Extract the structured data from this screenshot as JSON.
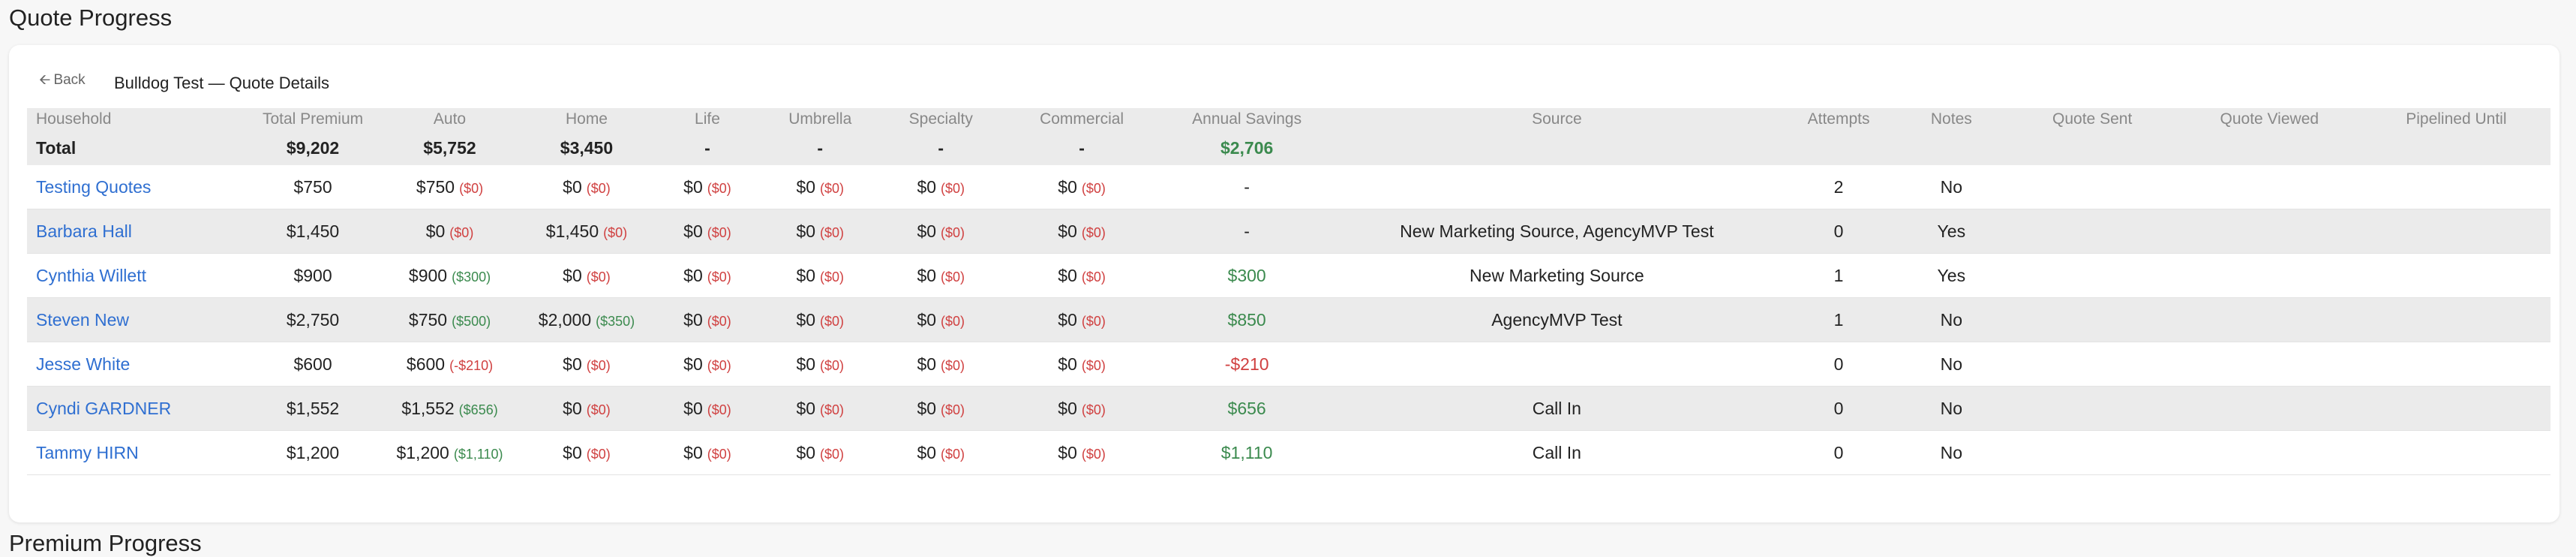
{
  "page": {
    "title": "Quote Progress",
    "next_section_title": "Premium Progress"
  },
  "card": {
    "back_label": "Back",
    "back_icon": "arrow-left-icon",
    "title": "Bulldog Test — Quote Details"
  },
  "colors": {
    "link": "#2f6fd1",
    "positive": "#3b8a4e",
    "negative": "#d04040",
    "stripe": "#ebebeb"
  },
  "table": {
    "headers": {
      "household": "Household",
      "total_premium": "Total Premium",
      "auto": "Auto",
      "home": "Home",
      "life": "Life",
      "umbrella": "Umbrella",
      "specialty": "Specialty",
      "commercial": "Commercial",
      "annual_savings": "Annual Savings",
      "source": "Source",
      "attempts": "Attempts",
      "notes": "Notes",
      "quote_sent": "Quote Sent",
      "quote_viewed": "Quote Viewed",
      "pipelined_until": "Pipelined Until"
    },
    "total": {
      "label": "Total",
      "total_premium": "$9,202",
      "auto": "$5,752",
      "home": "$3,450",
      "life": "-",
      "umbrella": "-",
      "specialty": "-",
      "commercial": "-",
      "annual_savings": "$2,706"
    },
    "rows": [
      {
        "household": "Testing Quotes",
        "total_premium": "$750",
        "auto": {
          "value": "$750",
          "delta": "($0)",
          "sign": "neg"
        },
        "home": {
          "value": "$0",
          "delta": "($0)",
          "sign": "neg"
        },
        "life": {
          "value": "$0",
          "delta": "($0)",
          "sign": "neg"
        },
        "umbrella": {
          "value": "$0",
          "delta": "($0)",
          "sign": "neg"
        },
        "specialty": {
          "value": "$0",
          "delta": "($0)",
          "sign": "neg"
        },
        "commercial": {
          "value": "$0",
          "delta": "($0)",
          "sign": "neg"
        },
        "annual_savings": {
          "value": "-",
          "sign": "none"
        },
        "source": "",
        "attempts": "2",
        "notes": "No",
        "quote_sent": "",
        "quote_viewed": "",
        "pipelined_until": ""
      },
      {
        "household": "Barbara Hall",
        "total_premium": "$1,450",
        "auto": {
          "value": "$0",
          "delta": "($0)",
          "sign": "neg"
        },
        "home": {
          "value": "$1,450",
          "delta": "($0)",
          "sign": "neg"
        },
        "life": {
          "value": "$0",
          "delta": "($0)",
          "sign": "neg"
        },
        "umbrella": {
          "value": "$0",
          "delta": "($0)",
          "sign": "neg"
        },
        "specialty": {
          "value": "$0",
          "delta": "($0)",
          "sign": "neg"
        },
        "commercial": {
          "value": "$0",
          "delta": "($0)",
          "sign": "neg"
        },
        "annual_savings": {
          "value": "-",
          "sign": "none"
        },
        "source": "New Marketing Source, AgencyMVP Test",
        "attempts": "0",
        "notes": "Yes",
        "quote_sent": "",
        "quote_viewed": "",
        "pipelined_until": ""
      },
      {
        "household": "Cynthia Willett",
        "total_premium": "$900",
        "auto": {
          "value": "$900",
          "delta": "($300)",
          "sign": "pos"
        },
        "home": {
          "value": "$0",
          "delta": "($0)",
          "sign": "neg"
        },
        "life": {
          "value": "$0",
          "delta": "($0)",
          "sign": "neg"
        },
        "umbrella": {
          "value": "$0",
          "delta": "($0)",
          "sign": "neg"
        },
        "specialty": {
          "value": "$0",
          "delta": "($0)",
          "sign": "neg"
        },
        "commercial": {
          "value": "$0",
          "delta": "($0)",
          "sign": "neg"
        },
        "annual_savings": {
          "value": "$300",
          "sign": "pos"
        },
        "source": "New Marketing Source",
        "attempts": "1",
        "notes": "Yes",
        "quote_sent": "",
        "quote_viewed": "",
        "pipelined_until": ""
      },
      {
        "household": "Steven New",
        "total_premium": "$2,750",
        "auto": {
          "value": "$750",
          "delta": "($500)",
          "sign": "pos"
        },
        "home": {
          "value": "$2,000",
          "delta": "($350)",
          "sign": "pos"
        },
        "life": {
          "value": "$0",
          "delta": "($0)",
          "sign": "neg"
        },
        "umbrella": {
          "value": "$0",
          "delta": "($0)",
          "sign": "neg"
        },
        "specialty": {
          "value": "$0",
          "delta": "($0)",
          "sign": "neg"
        },
        "commercial": {
          "value": "$0",
          "delta": "($0)",
          "sign": "neg"
        },
        "annual_savings": {
          "value": "$850",
          "sign": "pos"
        },
        "source": "AgencyMVP Test",
        "attempts": "1",
        "notes": "No",
        "quote_sent": "",
        "quote_viewed": "",
        "pipelined_until": ""
      },
      {
        "household": "Jesse White",
        "total_premium": "$600",
        "auto": {
          "value": "$600",
          "delta": "(-$210)",
          "sign": "neg"
        },
        "home": {
          "value": "$0",
          "delta": "($0)",
          "sign": "neg"
        },
        "life": {
          "value": "$0",
          "delta": "($0)",
          "sign": "neg"
        },
        "umbrella": {
          "value": "$0",
          "delta": "($0)",
          "sign": "neg"
        },
        "specialty": {
          "value": "$0",
          "delta": "($0)",
          "sign": "neg"
        },
        "commercial": {
          "value": "$0",
          "delta": "($0)",
          "sign": "neg"
        },
        "annual_savings": {
          "value": "-$210",
          "sign": "neg"
        },
        "source": "",
        "attempts": "0",
        "notes": "No",
        "quote_sent": "",
        "quote_viewed": "",
        "pipelined_until": ""
      },
      {
        "household": "Cyndi GARDNER",
        "total_premium": "$1,552",
        "auto": {
          "value": "$1,552",
          "delta": "($656)",
          "sign": "pos"
        },
        "home": {
          "value": "$0",
          "delta": "($0)",
          "sign": "neg"
        },
        "life": {
          "value": "$0",
          "delta": "($0)",
          "sign": "neg"
        },
        "umbrella": {
          "value": "$0",
          "delta": "($0)",
          "sign": "neg"
        },
        "specialty": {
          "value": "$0",
          "delta": "($0)",
          "sign": "neg"
        },
        "commercial": {
          "value": "$0",
          "delta": "($0)",
          "sign": "neg"
        },
        "annual_savings": {
          "value": "$656",
          "sign": "pos"
        },
        "source": "Call In",
        "attempts": "0",
        "notes": "No",
        "quote_sent": "",
        "quote_viewed": "",
        "pipelined_until": ""
      },
      {
        "household": "Tammy HIRN",
        "total_premium": "$1,200",
        "auto": {
          "value": "$1,200",
          "delta": "($1,110)",
          "sign": "pos"
        },
        "home": {
          "value": "$0",
          "delta": "($0)",
          "sign": "neg"
        },
        "life": {
          "value": "$0",
          "delta": "($0)",
          "sign": "neg"
        },
        "umbrella": {
          "value": "$0",
          "delta": "($0)",
          "sign": "neg"
        },
        "specialty": {
          "value": "$0",
          "delta": "($0)",
          "sign": "neg"
        },
        "commercial": {
          "value": "$0",
          "delta": "($0)",
          "sign": "neg"
        },
        "annual_savings": {
          "value": "$1,110",
          "sign": "pos"
        },
        "source": "Call In",
        "attempts": "0",
        "notes": "No",
        "quote_sent": "",
        "quote_viewed": "",
        "pipelined_until": ""
      }
    ]
  }
}
